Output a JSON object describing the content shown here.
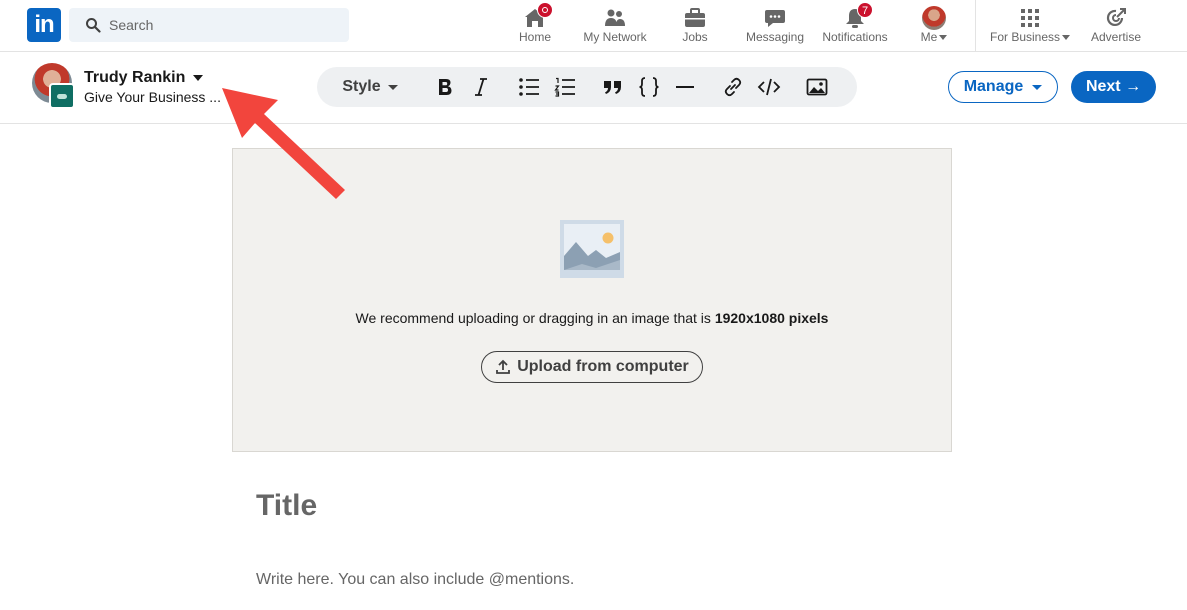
{
  "nav": {
    "logo": "in",
    "search_placeholder": "Search",
    "items": [
      {
        "label": "Home"
      },
      {
        "label": "My Network"
      },
      {
        "label": "Jobs"
      },
      {
        "label": "Messaging"
      },
      {
        "label": "Notifications",
        "badge": "7"
      },
      {
        "label": "Me"
      },
      {
        "label": "For Business"
      },
      {
        "label": "Advertise"
      }
    ]
  },
  "author": {
    "name": "Trudy Rankin",
    "subtitle": "Give Your Business ..."
  },
  "toolbar": {
    "style_label": "Style",
    "tools": [
      "bold-icon",
      "italic-icon",
      "bulleted-list-icon",
      "numbered-list-icon",
      "quote-icon",
      "code-block-icon",
      "divider-icon",
      "link-icon",
      "embed-icon",
      "image-icon"
    ]
  },
  "actions": {
    "manage_label": "Manage",
    "next_label": "Next →"
  },
  "cover": {
    "recommend_prefix": "We recommend uploading or dragging in an image that is ",
    "recommend_size": "1920x1080 pixels",
    "upload_label": "Upload from computer"
  },
  "editor": {
    "title_placeholder": "Title",
    "body_placeholder": "Write here. You can also include @mentions."
  },
  "colors": {
    "brand": "#0a66c2",
    "badge": "#cb112d",
    "annotation_arrow": "#f2453d"
  }
}
